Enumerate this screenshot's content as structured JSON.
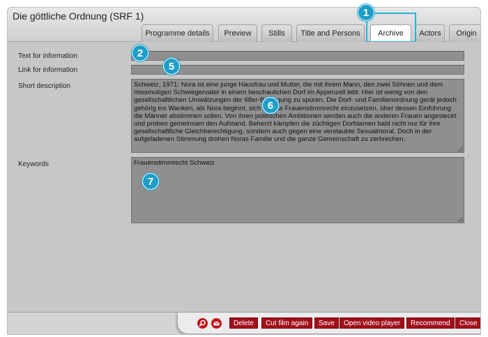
{
  "window": {
    "title": "Die göttliche Ordnung (SRF 1)"
  },
  "tabs": [
    {
      "label": "Programme details",
      "active": false
    },
    {
      "label": "Preview",
      "active": false
    },
    {
      "label": "Stills",
      "active": false
    },
    {
      "label": "Title and Persons",
      "active": false
    },
    {
      "label": "Archive",
      "active": true
    },
    {
      "label": "Actors",
      "active": false
    },
    {
      "label": "Origin",
      "active": false
    }
  ],
  "fields": {
    "text_for_information": {
      "label": "Text for information",
      "value": ""
    },
    "link_for_information": {
      "label": "Link for information",
      "value": ""
    },
    "short_description": {
      "label": "Short description",
      "value": "Schweiz, 1971: Nora ist eine junge Hausfrau und Mutter, die mit ihrem Mann, den zwei Söhnen und dem missmutigen Schwiegervater in einem beschaulichen Dorf im Appenzell lebt. Hier ist wenig von den gesellschaftlichen Umwälzungen der 68er-Bewegung zu spüren. Die Dorf- und Familienordnung gerät jedoch gehörig ins Wanken, als Nora beginnt, sich für das Frauenstimmrecht einzusetzen, über dessen Einführung die Männer abstimmen sollen. Von ihren politischen Ambitionen werden auch die anderen Frauen angesteckt und proben gemeinsam den Aufstand. Beherzt kämpfen die züchtigen Dorfdamen bald nicht nur für ihre gesellschaftliche Gleichberechtigung, sondern auch gegen eine verstaubte Sexualmoral. Doch in der aufgeladenen Stimmung drohen Noras Familie und die ganze Gemeinschaft zu zerbrechen."
    },
    "keywords": {
      "label": "Keywords",
      "value": "Frauenstimmrecht Schweiz"
    }
  },
  "badges": [
    "1",
    "2",
    "5",
    "6",
    "7"
  ],
  "toolbar": {
    "icons": [
      "search-icon",
      "mail-icon"
    ],
    "buttons": [
      {
        "label": "Delete"
      },
      {
        "label": "Cut film again"
      },
      {
        "label": "Save"
      },
      {
        "label": "Open video player"
      },
      {
        "label": "Recommend"
      },
      {
        "label": "Close"
      }
    ]
  },
  "colors": {
    "accent": "#1d9ec9",
    "button_red": "#a1101a",
    "field_gray": "#8f8f8f"
  }
}
